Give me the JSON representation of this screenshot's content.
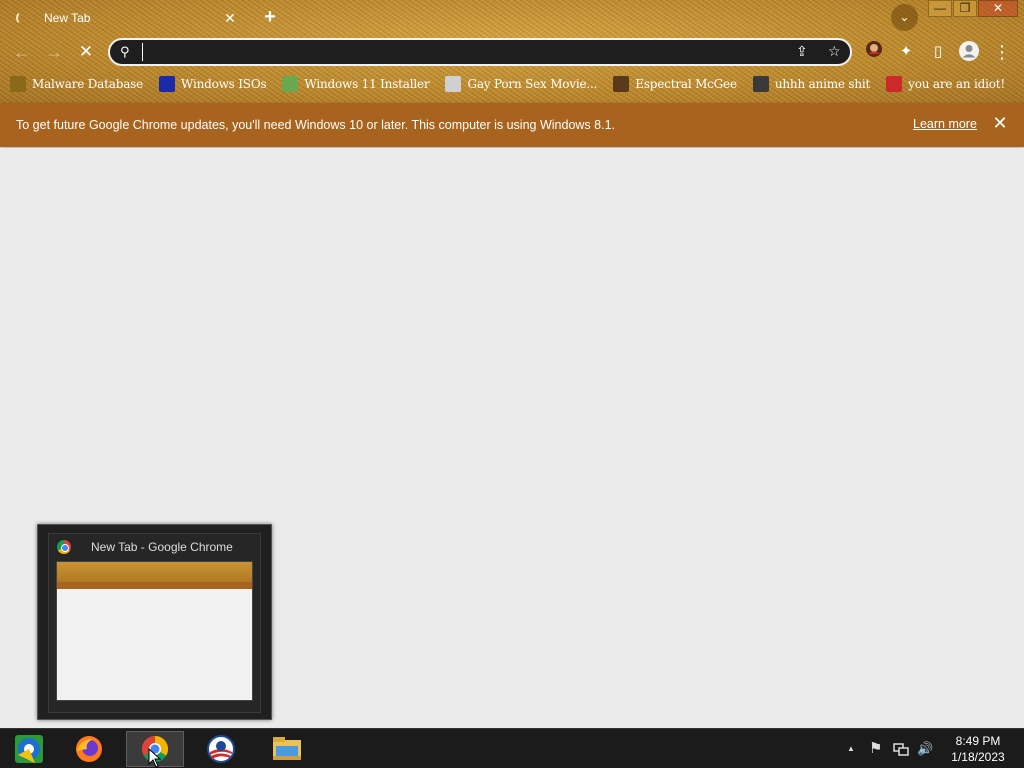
{
  "window": {
    "tab_title": "New Tab",
    "tab_close": "✕",
    "new_tab": "+",
    "tab_search": "⌄",
    "controls": {
      "minimize": "—",
      "restore": "❐",
      "close": "✕"
    }
  },
  "toolbar": {
    "back": "←",
    "forward": "→",
    "stop": "✕",
    "search_icon": "⚲",
    "address_value": "",
    "share": "⇪",
    "star": "☆",
    "extensions": "✦",
    "side_panel": "▯",
    "menu": "⋮"
  },
  "bookmarks": [
    {
      "label": "Malware Database",
      "color": "#8a6a1a"
    },
    {
      "label": "Windows ISOs",
      "color": "#1a2aa8"
    },
    {
      "label": "Windows 11 Installer",
      "color": "#6aa84f"
    },
    {
      "label": "Gay Porn Sex Movie...",
      "color": "#d0d0d0"
    },
    {
      "label": "Espectral McGee",
      "color": "#5a3a1a"
    },
    {
      "label": "uhhh anime shit",
      "color": "#3a3a3a"
    },
    {
      "label": "you are an idiot!",
      "color": "#cc2a2a"
    }
  ],
  "infobar": {
    "message": "To get future Google Chrome updates, you'll need Windows 10 or later. This computer is using Windows 8.1.",
    "learn_more": "Learn more",
    "close": "✕"
  },
  "thumbnail": {
    "title": "New Tab - Google Chrome"
  },
  "taskbar": {
    "tray_arrow": "▲",
    "flag": "⚑",
    "volume": "🔊",
    "time": "8:49 PM",
    "date": "1/18/2023"
  }
}
